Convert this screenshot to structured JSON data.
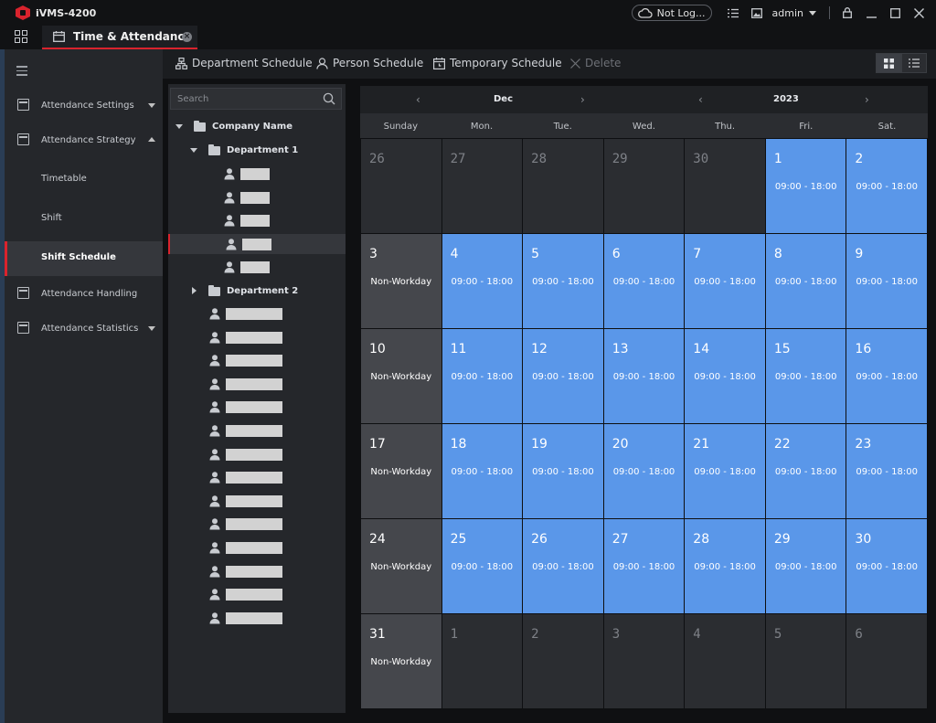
{
  "app": {
    "title": "iVMS-4200"
  },
  "titlebar": {
    "cloud_status": "Not Log...",
    "user": "admin"
  },
  "tab": {
    "label": "Time & Attendance"
  },
  "sidebar": {
    "items": [
      {
        "label": "Attendance Settings"
      },
      {
        "label": "Attendance Strategy"
      },
      {
        "label": "Timetable"
      },
      {
        "label": "Shift"
      },
      {
        "label": "Shift Schedule"
      },
      {
        "label": "Attendance Handling"
      },
      {
        "label": "Attendance Statistics"
      }
    ]
  },
  "toolbar": {
    "department_schedule": "Department Schedule",
    "person_schedule": "Person Schedule",
    "temporary_schedule": "Temporary Schedule",
    "delete": "Delete"
  },
  "tree": {
    "search_placeholder": "Search",
    "company": "Company Name",
    "dept1": "Department 1",
    "dept2": "Department 2"
  },
  "calendar": {
    "month": "Dec",
    "year": "2023",
    "weekdays": [
      "Sunday",
      "Mon.",
      "Tue.",
      "Wed.",
      "Thu.",
      "Fri.",
      "Sat."
    ],
    "work_shift": "09:00 - 18:00",
    "non_workday": "Non-Workday",
    "days": [
      {
        "d": "26",
        "t": "other"
      },
      {
        "d": "27",
        "t": "other"
      },
      {
        "d": "28",
        "t": "other"
      },
      {
        "d": "29",
        "t": "other"
      },
      {
        "d": "30",
        "t": "other"
      },
      {
        "d": "1",
        "t": "work"
      },
      {
        "d": "2",
        "t": "work"
      },
      {
        "d": "3",
        "t": "off"
      },
      {
        "d": "4",
        "t": "work"
      },
      {
        "d": "5",
        "t": "work"
      },
      {
        "d": "6",
        "t": "work"
      },
      {
        "d": "7",
        "t": "work"
      },
      {
        "d": "8",
        "t": "work"
      },
      {
        "d": "9",
        "t": "work"
      },
      {
        "d": "10",
        "t": "off"
      },
      {
        "d": "11",
        "t": "work"
      },
      {
        "d": "12",
        "t": "work"
      },
      {
        "d": "13",
        "t": "work"
      },
      {
        "d": "14",
        "t": "work"
      },
      {
        "d": "15",
        "t": "work"
      },
      {
        "d": "16",
        "t": "work"
      },
      {
        "d": "17",
        "t": "off"
      },
      {
        "d": "18",
        "t": "work"
      },
      {
        "d": "19",
        "t": "work"
      },
      {
        "d": "20",
        "t": "work"
      },
      {
        "d": "21",
        "t": "work"
      },
      {
        "d": "22",
        "t": "work"
      },
      {
        "d": "23",
        "t": "work"
      },
      {
        "d": "24",
        "t": "off"
      },
      {
        "d": "25",
        "t": "work"
      },
      {
        "d": "26",
        "t": "work"
      },
      {
        "d": "27",
        "t": "work"
      },
      {
        "d": "28",
        "t": "work"
      },
      {
        "d": "29",
        "t": "work"
      },
      {
        "d": "30",
        "t": "work"
      },
      {
        "d": "31",
        "t": "off"
      },
      {
        "d": "1",
        "t": "other"
      },
      {
        "d": "2",
        "t": "other"
      },
      {
        "d": "3",
        "t": "other"
      },
      {
        "d": "4",
        "t": "other"
      },
      {
        "d": "5",
        "t": "other"
      },
      {
        "d": "6",
        "t": "other"
      }
    ]
  }
}
